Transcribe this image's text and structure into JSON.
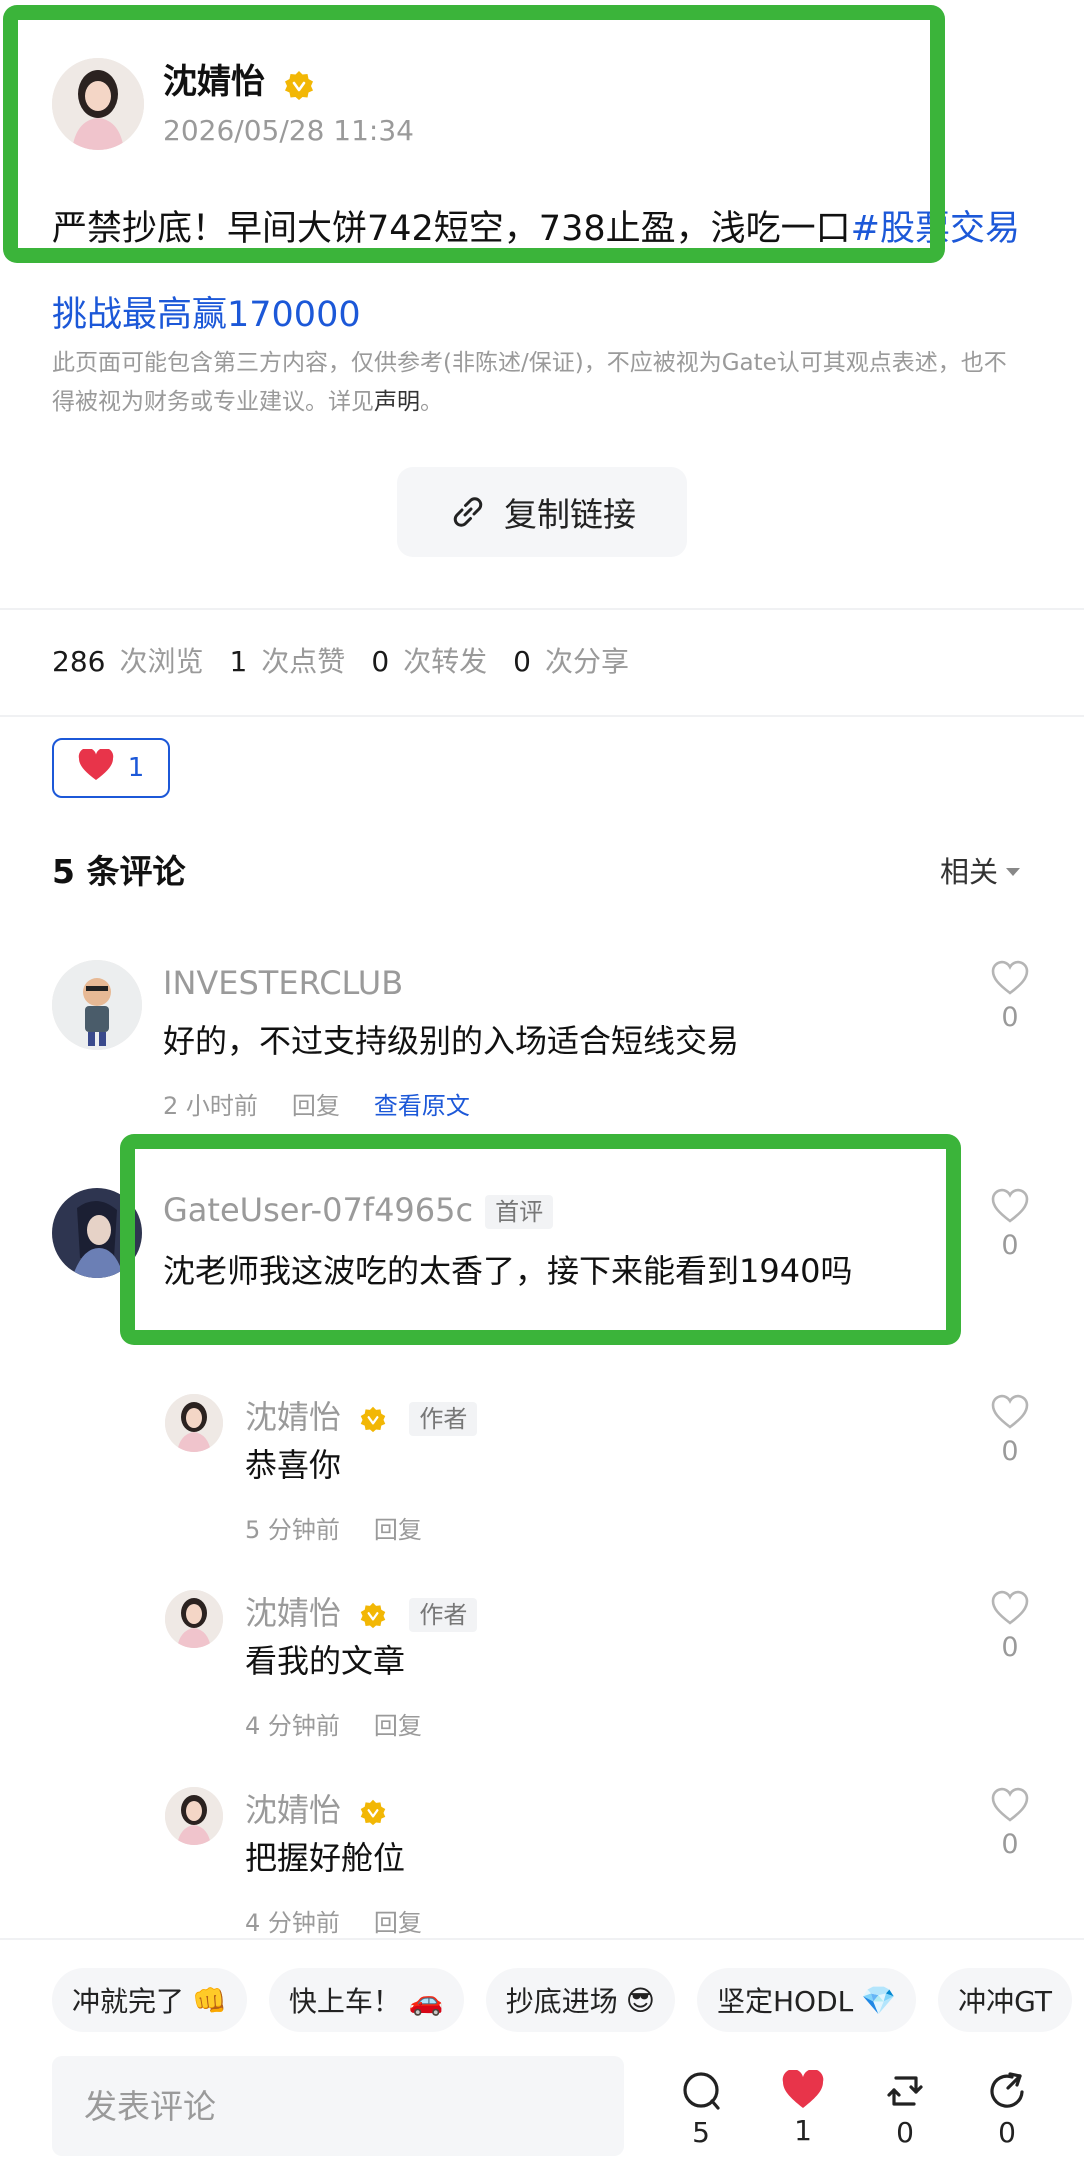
{
  "post": {
    "author": "沈婧怡",
    "time": "2026/05/28 11:34",
    "text": "严禁抄底！早间大饼742短空，738止盈，浅吃一口",
    "hashtag": "#股票交易挑战最高赢170000"
  },
  "disclaimer": {
    "text": "此页面可能包含第三方内容，仅供参考(非陈述/保证)，不应被视为Gate认可其观点表述，也不得被视为财务或专业建议。详见",
    "link": "声明",
    "end": "。"
  },
  "copy_link": {
    "label": "复制链接"
  },
  "stats": {
    "views": "286",
    "views_label": "次浏览",
    "likes": "1",
    "likes_label": "次点赞",
    "reposts": "0",
    "reposts_label": "次转发",
    "shares": "0",
    "shares_label": "次分享"
  },
  "reaction": {
    "count": "1"
  },
  "comments_header": {
    "count_label": "5 条评论",
    "sort": "相关"
  },
  "comments": [
    {
      "name": "INVESTERCLUB",
      "text": "好的，不过支持级别的入场适合短线交易",
      "time": "2 小时前",
      "reply": "回复",
      "view_original": "查看原文",
      "likes": "0"
    },
    {
      "name": "GateUser-07f4965c",
      "tag": "首评",
      "text": "沈老师我这波吃的太香了，接下来能看到1940吗",
      "likes": "0"
    }
  ],
  "replies": [
    {
      "name": "沈婧怡",
      "tag": "作者",
      "text": "恭喜你",
      "time": "5 分钟前",
      "reply": "回复",
      "likes": "0"
    },
    {
      "name": "沈婧怡",
      "tag": "作者",
      "text": "看我的文章",
      "time": "4 分钟前",
      "reply": "回复",
      "likes": "0"
    },
    {
      "name": "沈婧怡",
      "text": "把握好舱位",
      "time": "4 分钟前",
      "reply": "回复",
      "likes": "0"
    }
  ],
  "quick_replies": [
    {
      "label": "冲就完了",
      "emoji": "👊"
    },
    {
      "label": "快上车！",
      "emoji": "🚗"
    },
    {
      "label": "抄底进场",
      "emoji": "😎"
    },
    {
      "label": "坚定HODL",
      "emoji": "💎"
    },
    {
      "label": "冲冲GT",
      "emoji": ""
    }
  ],
  "composer": {
    "placeholder": "发表评论"
  },
  "actions": {
    "comments": "5",
    "likes": "1",
    "reposts": "0",
    "shares": "0"
  },
  "colors": {
    "accent": "#1c58d8",
    "highlight": "#3bb43a",
    "heart": "#e8344a",
    "verified": "#f2b705"
  }
}
